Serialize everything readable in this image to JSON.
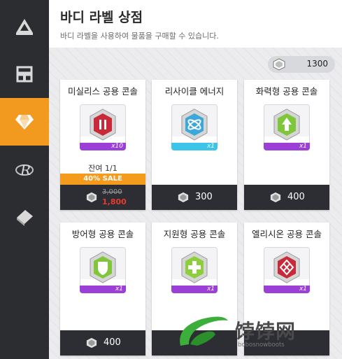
{
  "header": {
    "title": "바디 라벨 상점",
    "subtitle": "바디 라벨을 사용하여 물품을 구매할 수 있습니다."
  },
  "currency": {
    "amount": "1300",
    "icon": "gem-icon"
  },
  "sidebar": {
    "items": [
      {
        "icon": "mountain-icon",
        "active": false
      },
      {
        "icon": "station-icon",
        "active": false
      },
      {
        "icon": "diamond-icon",
        "active": true
      },
      {
        "icon": "r-logo-icon",
        "active": false
      },
      {
        "icon": "ticket-icon",
        "active": false
      }
    ]
  },
  "cards": [
    {
      "name": "미실리스 공용 콘솔",
      "qty": "x10",
      "remaining": "잔여 1/1",
      "sale": "40% SALE",
      "old_price": "3,000",
      "price": "1,800",
      "color": "#c92a3a",
      "strip": "#9b3fd6"
    },
    {
      "name": "리사이클 에너지",
      "qty": "x1",
      "price": "300",
      "color": "#3aa8d8",
      "strip": "#3cc4ea"
    },
    {
      "name": "화력형 공용 콘솔",
      "qty": "x1",
      "price": "400",
      "color": "#7fc63a",
      "strip": "#9b3fd6"
    },
    {
      "name": "방어형 공용 콘솔",
      "qty": "x1",
      "price": "400",
      "color": "#7fc63a",
      "strip": "#9b3fd6"
    },
    {
      "name": "지원형 공용 콘솔",
      "qty": "x1",
      "price": "",
      "color": "#8ccf3a",
      "strip": "#9b3fd6"
    },
    {
      "name": "엘리시온 공용 콘솔",
      "qty": "x1",
      "price": "",
      "color": "#c92a3a",
      "strip": "#9b3fd6"
    }
  ],
  "watermark": {
    "text": "饽饽网",
    "sub": "bobosnowboots"
  }
}
